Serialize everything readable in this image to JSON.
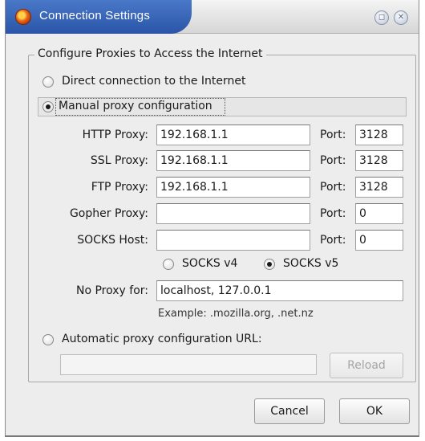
{
  "window": {
    "title": "Connection Settings"
  },
  "group": {
    "title": "Configure Proxies to Access the Internet"
  },
  "options": {
    "direct": "Direct connection to the Internet",
    "manual": "Manual proxy configuration",
    "auto": "Automatic proxy configuration URL:"
  },
  "proxies": [
    {
      "label": "HTTP Proxy:",
      "host": "192.168.1.1",
      "port_label": "Port:",
      "port": "3128"
    },
    {
      "label": "SSL Proxy:",
      "host": "192.168.1.1",
      "port_label": "Port:",
      "port": "3128"
    },
    {
      "label": "FTP Proxy:",
      "host": "192.168.1.1",
      "port_label": "Port:",
      "port": "3128"
    },
    {
      "label": "Gopher Proxy:",
      "host": "",
      "port_label": "Port:",
      "port": "0"
    },
    {
      "label": "SOCKS Host:",
      "host": "",
      "port_label": "Port:",
      "port": "0"
    }
  ],
  "socks": {
    "v4": "SOCKS v4",
    "v5": "SOCKS v5",
    "selected": "v5"
  },
  "no_proxy": {
    "label": "No Proxy for:",
    "value": "localhost, 127.0.0.1",
    "example": "Example: .mozilla.org, .net.nz"
  },
  "auto_url": {
    "value": ""
  },
  "buttons": {
    "reload": "Reload",
    "cancel": "Cancel",
    "ok": "OK"
  },
  "icons": {
    "app": "firefox-icon",
    "restore": "restore-icon",
    "close": "close-icon"
  }
}
